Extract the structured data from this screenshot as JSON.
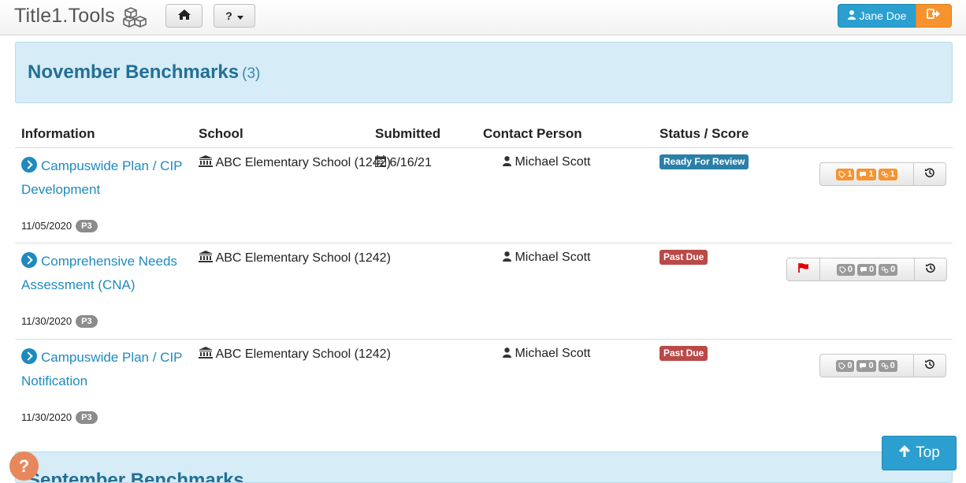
{
  "navbar": {
    "brand": "Title1.Tools",
    "home_icon": "home-icon",
    "help_label": "?",
    "user_name": "Jane Doe",
    "logout_icon": "sign-out-icon"
  },
  "section": {
    "title": "November Benchmarks",
    "count": "(3)"
  },
  "table": {
    "headers": [
      "Information",
      "School",
      "Submitted",
      "Contact Person",
      "Status / Score"
    ],
    "rows": [
      {
        "title": "Campuswide Plan / CIP Development",
        "date": "11/05/2020",
        "priority": "P3",
        "school": "ABC Elementary School (1242)",
        "submitted": "6/16/21",
        "contact": "Michael Scott",
        "status": "Ready For Review",
        "status_color": "#2b7fa7",
        "tags_count": "1",
        "comments_count": "1",
        "links_count": "1",
        "flag": false
      },
      {
        "title": "Comprehensive Needs Assessment (CNA)",
        "date": "11/30/2020",
        "priority": "P3",
        "school": "ABC Elementary School (1242)",
        "submitted": "",
        "contact": "Michael Scott",
        "status": "Past Due",
        "status_color": "#b94a48",
        "tags_count": "0",
        "comments_count": "0",
        "links_count": "0",
        "flag": true
      },
      {
        "title": "Campuswide Plan / CIP Notification",
        "date": "11/30/2020",
        "priority": "P3",
        "school": "ABC Elementary School (1242)",
        "submitted": "",
        "contact": "Michael Scott",
        "status": "Past Due",
        "status_color": "#b94a48",
        "tags_count": "0",
        "comments_count": "0",
        "links_count": "0",
        "flag": false
      }
    ]
  },
  "next_section": {
    "title": "September Benchmarks"
  },
  "help_badge": "?",
  "top_button": "Top",
  "colors": {
    "accent": "#2b9fcf",
    "link": "#1f8ac0",
    "orange": "#f7932e",
    "panel": "#d6ecf6"
  }
}
